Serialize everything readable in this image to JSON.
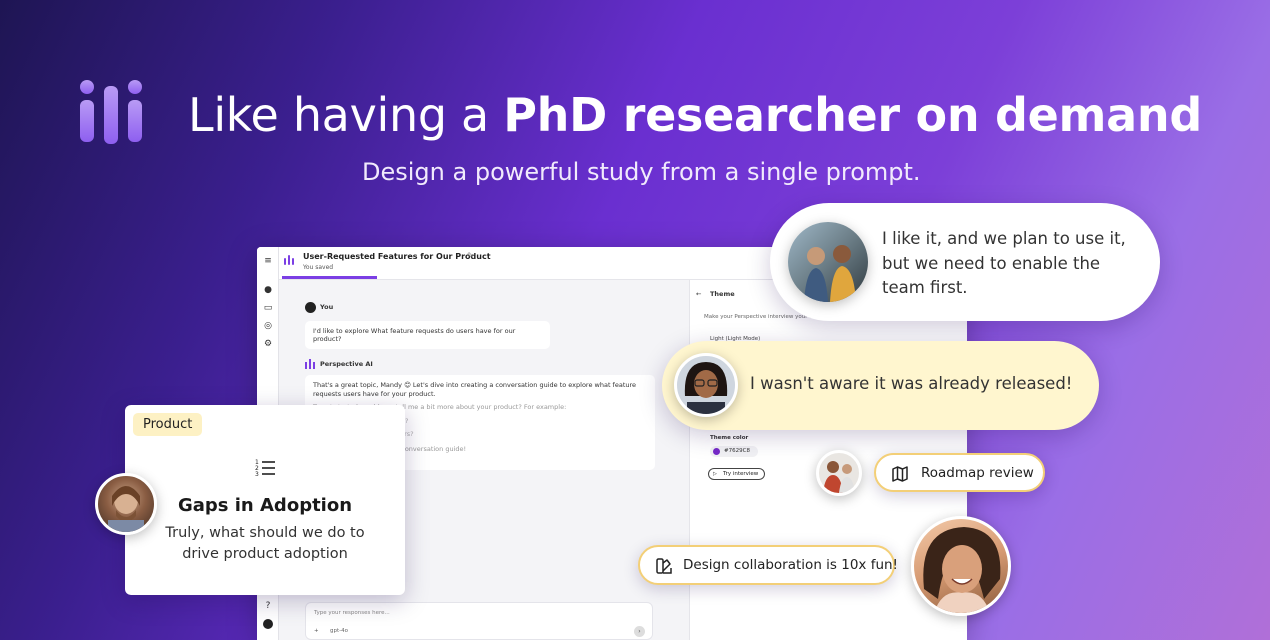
{
  "hero": {
    "title_regular": "Like having a ",
    "title_bold": "PhD researcher on demand",
    "subtitle": "Design a powerful study from a single prompt."
  },
  "app": {
    "title": "User-Requested Features for Our Product",
    "owner": "You saved",
    "chat": {
      "user_name": "You",
      "user_message": "I'd like to explore What feature requests do users have for our product?",
      "ai_name": "Perspective AI",
      "ai_message_1": "That's a great topic, Mandy 😊 Let's dive into creating a conversation guide to explore what feature requests users have for your product.",
      "ai_message_2": "To get started, could you tell me a bit more about your product? For example:",
      "ai_bullet_1": "What kind of product is it?",
      "ai_bullet_2": "Who are your typical users?",
      "ai_message_3": "This will help me tailor the conversation guide!",
      "input_placeholder": "Type your responses here...",
      "model_label": "gpt-4o"
    },
    "panel": {
      "back_title": "Theme",
      "description": "Make your Perspective interview your own.",
      "mode_label": "Light (Light Mode)",
      "theme_color_label": "Theme color",
      "theme_color_value": "#7629C8",
      "try_button": "Try interview"
    }
  },
  "cards": {
    "product_tag": "Product",
    "gaps_title": "Gaps in Adoption",
    "gaps_body": "Truly, what should we do to drive product adoption",
    "quote_1": "I like it, and we plan to use it, but we need to enable the team first.",
    "quote_2": "I wasn't aware it was already released!",
    "chip_roadmap": "Roadmap review",
    "chip_design": "Design collaboration is 10x fun!"
  },
  "colors": {
    "accent": "#7629C8",
    "chip_border": "#f3cf77",
    "quote_yellow": "#fff6cf"
  }
}
